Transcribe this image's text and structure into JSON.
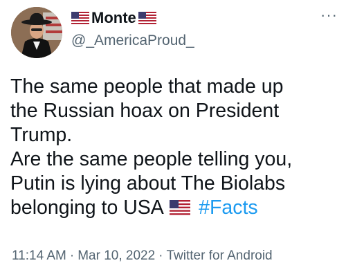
{
  "author": {
    "display_name": "Monte",
    "handle": "@_AmericaProud_",
    "name_flag_icon": "us-flag-icon"
  },
  "more_icon": "more-options-icon",
  "tweet": {
    "lines": [
      "The same people that made up",
      "the Russian hoax on President",
      "Trump.",
      "Are the same people telling you,",
      "Putin is lying about The Biolabs"
    ],
    "last_line_text": "belonging to USA",
    "inline_flag_icon": "us-flag-icon",
    "hashtag": "#Facts"
  },
  "meta": {
    "time": "11:14 AM",
    "date": "Mar 10, 2022",
    "source": "Twitter for Android",
    "separator": "·"
  },
  "colors": {
    "text": "#0f1419",
    "secondary": "#536471",
    "link": "#1d9bf0"
  }
}
